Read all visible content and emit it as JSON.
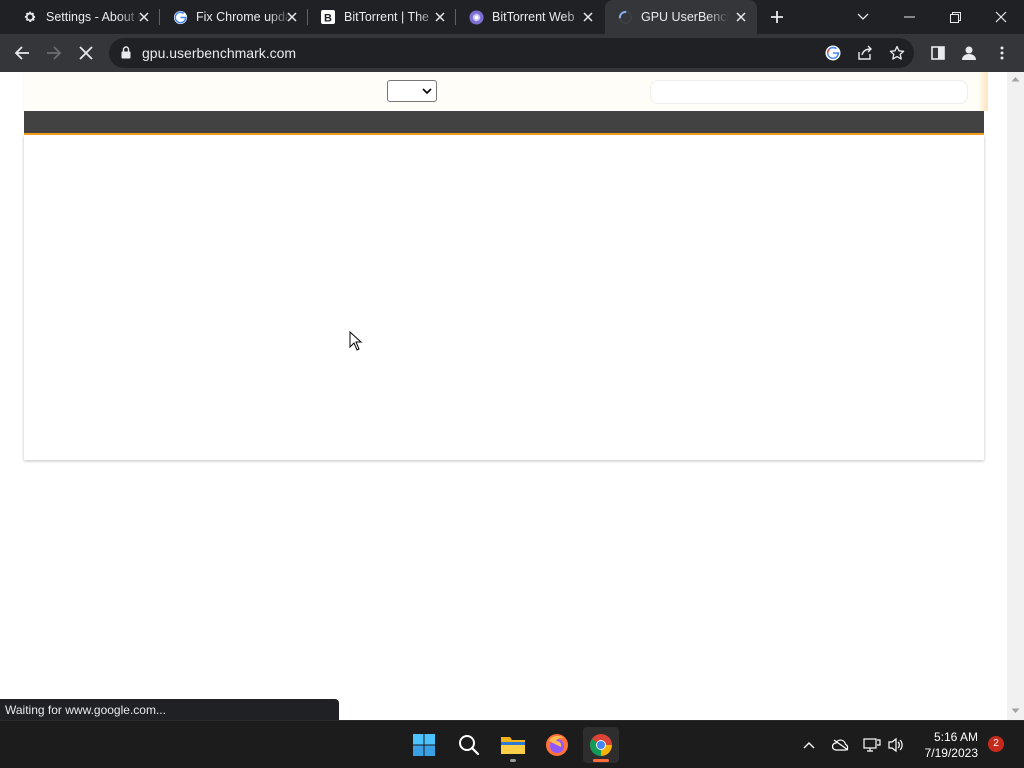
{
  "browser": {
    "tabs": [
      {
        "title": "Settings - About Chrome",
        "icon": "gear-icon",
        "active": false
      },
      {
        "title": "Fix Chrome update",
        "icon": "google-icon",
        "active": false
      },
      {
        "title": "BitTorrent | The",
        "icon": "bittorrent-b-icon",
        "active": false
      },
      {
        "title": "BitTorrent Web",
        "icon": "bittorrent-web-icon",
        "active": false
      },
      {
        "title": "GPU UserBenchmark",
        "icon": "loading-spinner-icon",
        "active": true
      }
    ],
    "address": "gpu.userbenchmark.com",
    "status_text": "Waiting for www.google.com..."
  },
  "taskbar": {
    "apps": [
      "start",
      "search",
      "file-explorer",
      "firefox",
      "chrome"
    ],
    "time": "5:16 AM",
    "date": "7/19/2023",
    "notification_count": "2"
  },
  "colors": {
    "tabstrip": "#202124",
    "toolbar": "#35363a",
    "site_nav": "#424242",
    "site_nav_accent": "#f7a21a",
    "taskbar": "#1c1c1c"
  }
}
